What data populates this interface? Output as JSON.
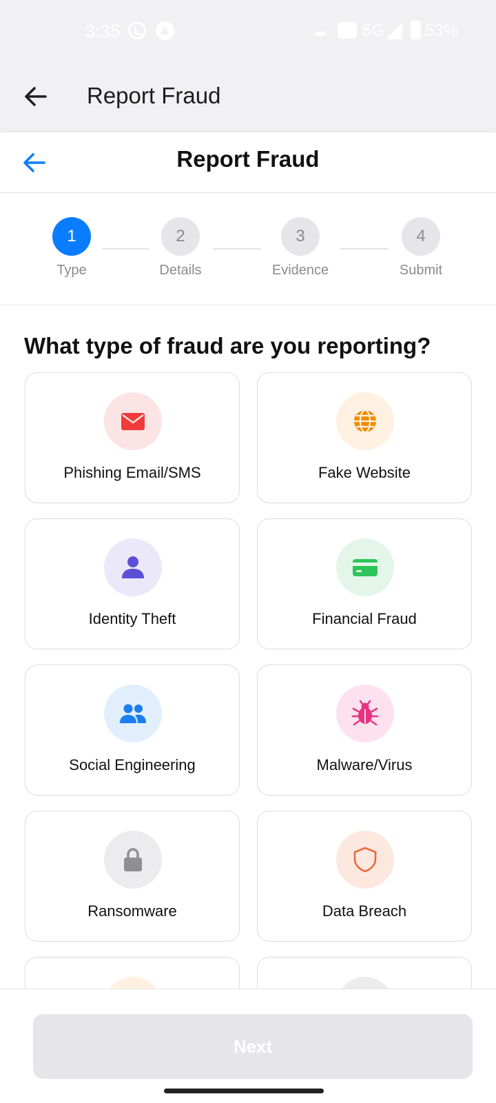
{
  "status_bar": {
    "time": "3:35",
    "network": "5G",
    "battery": "53%"
  },
  "appbar": {
    "title": "Report Fraud"
  },
  "header": {
    "title": "Report Fraud"
  },
  "stepper": {
    "steps": [
      {
        "number": "1",
        "label": "Type",
        "active": true
      },
      {
        "number": "2",
        "label": "Details",
        "active": false
      },
      {
        "number": "3",
        "label": "Evidence",
        "active": false
      },
      {
        "number": "4",
        "label": "Submit",
        "active": false
      }
    ]
  },
  "question": "What type of fraud are you reporting?",
  "fraud_types": [
    {
      "label": "Phishing Email/SMS",
      "icon": "mail-icon",
      "bg": "#fde4e4",
      "color": "#f03a3a"
    },
    {
      "label": "Fake Website",
      "icon": "globe-icon",
      "bg": "#fff1e2",
      "color": "#f08c00"
    },
    {
      "label": "Identity Theft",
      "icon": "person-icon",
      "bg": "#ebe9f9",
      "color": "#5a4fd6"
    },
    {
      "label": "Financial Fraud",
      "icon": "credit-card-icon",
      "bg": "#e4f6e9",
      "color": "#2fc55a"
    },
    {
      "label": "Social Engineering",
      "icon": "people-icon",
      "bg": "#e1eefc",
      "color": "#1c7df0"
    },
    {
      "label": "Malware/Virus",
      "icon": "bug-icon",
      "bg": "#fde1ef",
      "color": "#e8327f"
    },
    {
      "label": "Ransomware",
      "icon": "lock-icon",
      "bg": "#ececee",
      "color": "#8e8e93"
    },
    {
      "label": "Data Breach",
      "icon": "shield-icon",
      "bg": "#fde8e0",
      "color": "#ea6a3a"
    },
    {
      "label": "",
      "icon": "",
      "bg": "#fff1e2",
      "color": "#f08c00"
    },
    {
      "label": "",
      "icon": "",
      "bg": "#ececee",
      "color": "#8e8e93"
    }
  ],
  "footer": {
    "next_label": "Next"
  }
}
